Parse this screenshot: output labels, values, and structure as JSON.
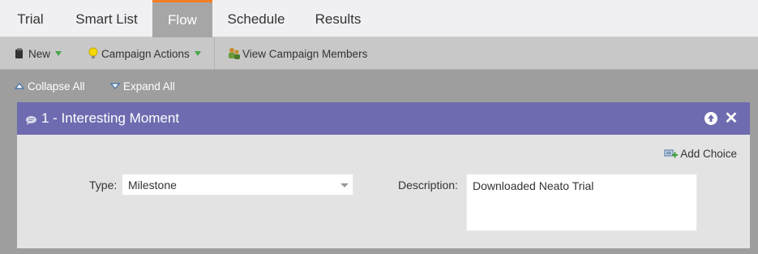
{
  "tabs": [
    {
      "label": "Trial"
    },
    {
      "label": "Smart List"
    },
    {
      "label": "Flow",
      "active": true
    },
    {
      "label": "Schedule"
    },
    {
      "label": "Results"
    }
  ],
  "toolbar": {
    "new_label": "New",
    "campaign_actions_label": "Campaign Actions",
    "view_members_label": "View Campaign Members"
  },
  "controls": {
    "collapse_all": "Collapse All",
    "expand_all": "Expand All"
  },
  "flow_step": {
    "title": "1 - Interesting Moment",
    "add_choice_label": "Add Choice",
    "type_label": "Type:",
    "type_value": "Milestone",
    "description_label": "Description:",
    "description_value": "Downloaded Neato Trial"
  },
  "colors": {
    "active_tab_accent": "#f47e24",
    "step_header": "#6e6bb0",
    "caret_green": "#49a64a"
  }
}
